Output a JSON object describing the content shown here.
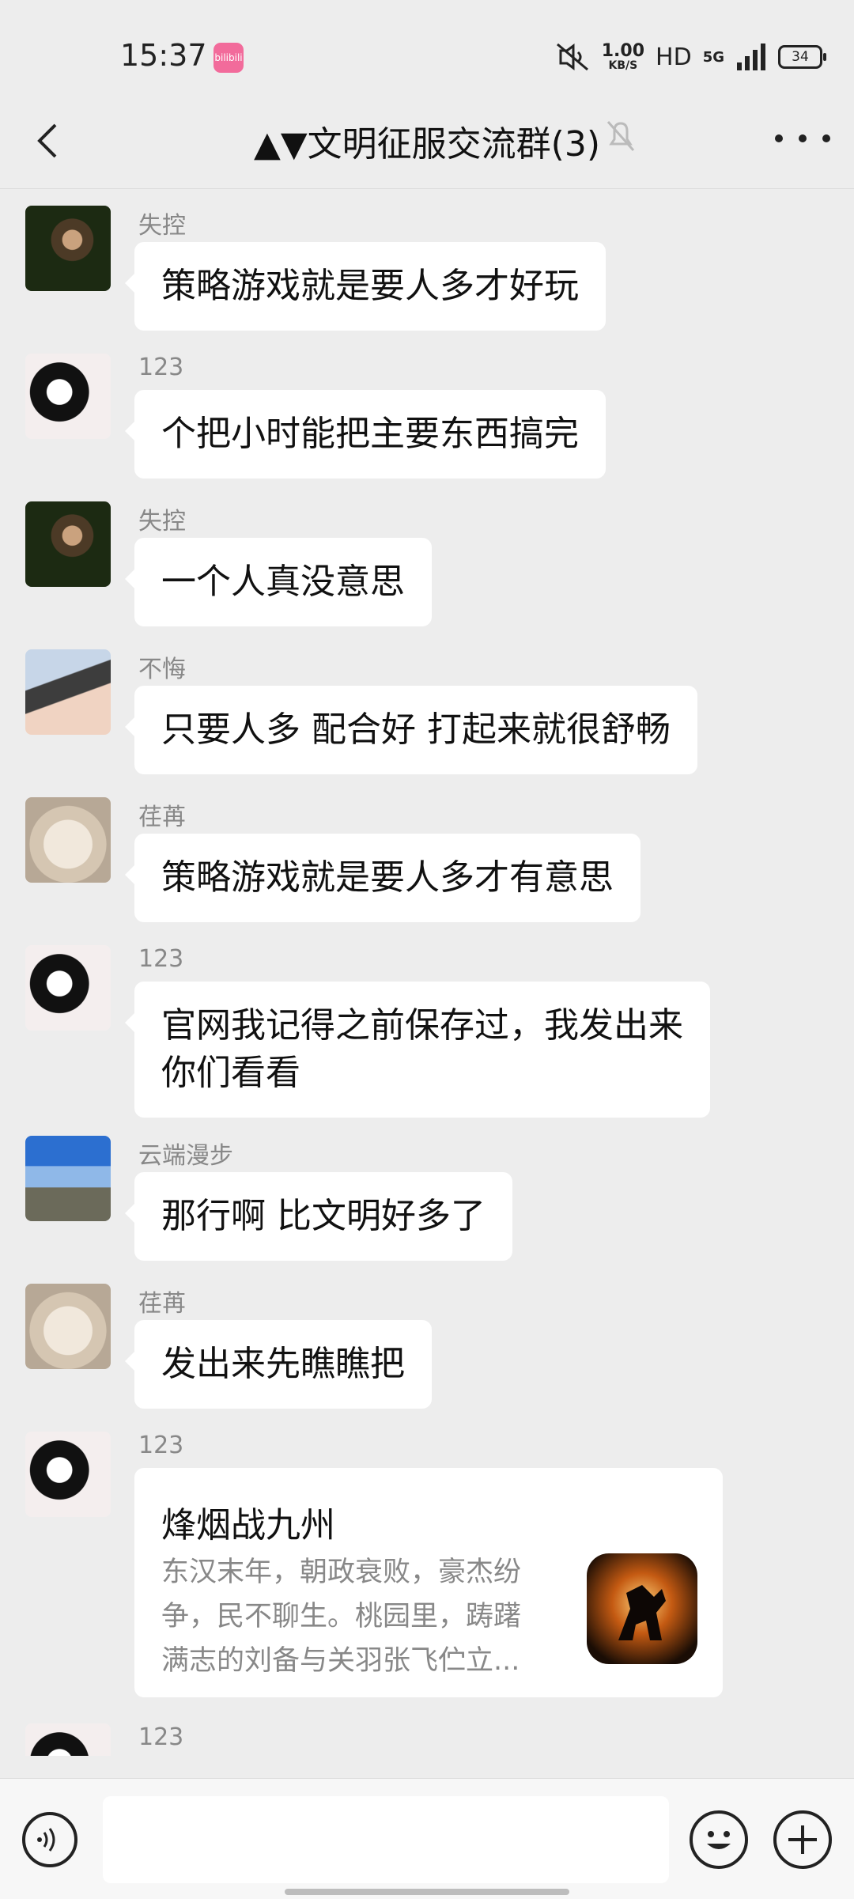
{
  "status_bar": {
    "time": "15:37",
    "app_badge": "bilibili",
    "net_speed_value": "1.00",
    "net_speed_unit": "KB/S",
    "hd": "HD",
    "network": "5G",
    "battery": "34"
  },
  "header": {
    "title": "▲▼文明征服交流群(3)",
    "icons": [
      "back-icon",
      "mute-bell-icon",
      "more-icon"
    ]
  },
  "messages": [
    {
      "sender": "失控",
      "text": "策略游戏就是要人多才好玩"
    },
    {
      "sender": "123",
      "text": "个把小时能把主要东西搞完"
    },
    {
      "sender": "失控",
      "text": "一个人真没意思"
    },
    {
      "sender": "不悔",
      "text": "只要人多 配合好 打起来就很舒畅"
    },
    {
      "sender": "荏苒",
      "text": "策略游戏就是要人多才有意思"
    },
    {
      "sender": "123",
      "text_line1": "官网我记得之前保存过，我发出来",
      "text_line2": "你们看看"
    },
    {
      "sender": "云端漫步",
      "text": "那行啊  比文明好多了"
    },
    {
      "sender": "荏苒",
      "text": "发出来先瞧瞧把"
    },
    {
      "sender": "123",
      "card_title": "烽烟战九州",
      "card_desc": "东汉末年，朝政衰败，豪杰纷争，民不聊生。桃园里，踌躇满志的刘备与关羽张飞伫立..."
    },
    {
      "sender": "123"
    }
  ],
  "input_bar": {
    "placeholder": "",
    "icons": [
      "voice-icon",
      "emoji-icon",
      "plus-icon"
    ]
  }
}
